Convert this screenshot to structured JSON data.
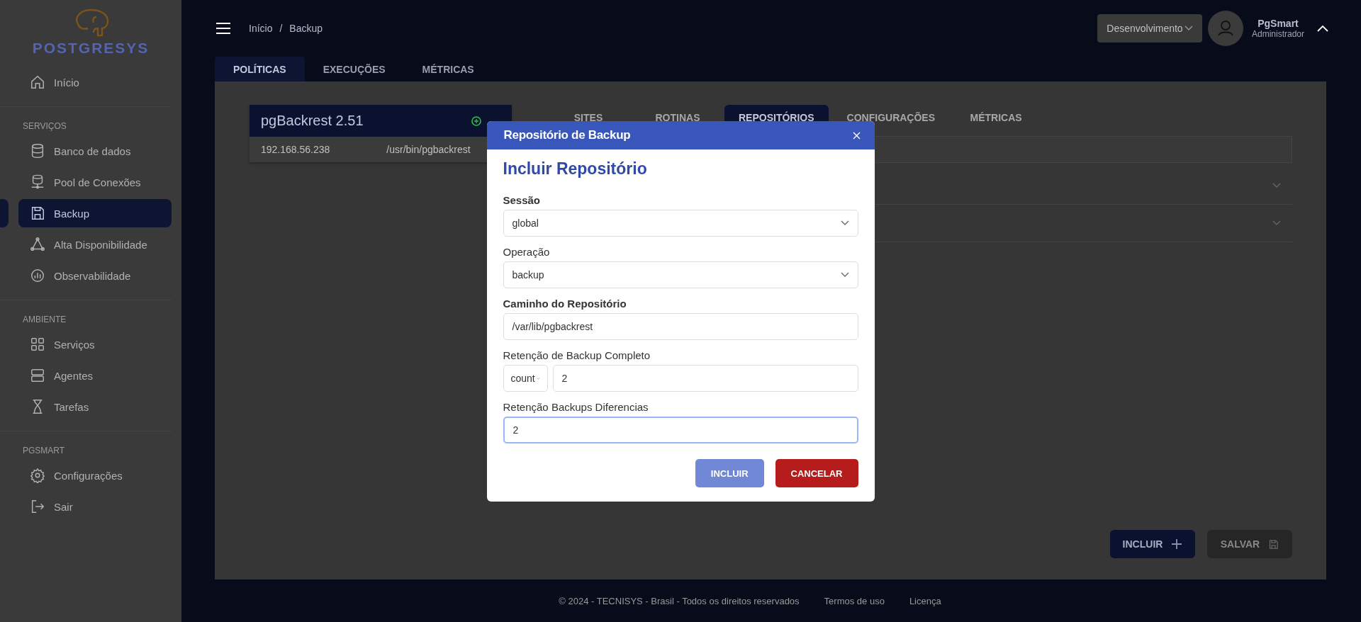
{
  "logo": {
    "text": "POSTGRESYS"
  },
  "sidebar": {
    "sections": [
      {
        "items": [
          {
            "label": "Início",
            "selected": false
          }
        ]
      },
      {
        "heading": "SERVIÇOS",
        "items": [
          {
            "label": "Banco de dados",
            "selected": false
          },
          {
            "label": "Pool de Conexões",
            "selected": false
          },
          {
            "label": "Backup",
            "selected": true
          },
          {
            "label": "Alta Disponibilidade",
            "selected": false
          },
          {
            "label": "Observabilidade",
            "selected": false
          }
        ]
      },
      {
        "heading": "AMBIENTE",
        "items": [
          {
            "label": "Serviços",
            "selected": false
          },
          {
            "label": "Agentes",
            "selected": false
          },
          {
            "label": "Tarefas",
            "selected": false
          }
        ]
      },
      {
        "heading": "PGSMART",
        "items": [
          {
            "label": "Configurações",
            "selected": false
          },
          {
            "label": "Sair",
            "selected": false
          }
        ]
      }
    ]
  },
  "breadcrumb": [
    "Início",
    "/",
    "Backup"
  ],
  "environment": {
    "value": "Desenvolvimento"
  },
  "user": {
    "name": "PgSmart",
    "role": "Administrador"
  },
  "tabs": [
    {
      "label": "POLÍTICAS",
      "selected": true
    },
    {
      "label": "EXECUÇÕES",
      "selected": false
    },
    {
      "label": "MÉTRICAS",
      "selected": false
    }
  ],
  "server_card": {
    "title": "pgBackrest 2.51",
    "host": "192.168.56.238",
    "path": "/usr/bin/pgbackrest"
  },
  "subtabs": [
    {
      "label": "SITES",
      "selected": false
    },
    {
      "label": "ROTINAS",
      "selected": false
    },
    {
      "label": "REPOSITÓRIOS",
      "selected": true
    },
    {
      "label": "CONFIGURAÇÕES",
      "selected": false
    },
    {
      "label": "MÉTRICAS",
      "selected": false
    }
  ],
  "actions": [
    {
      "label": "INCLUIR",
      "kind": "add",
      "disabled": false
    },
    {
      "label": "SALVAR",
      "kind": "save",
      "disabled": true
    }
  ],
  "footer": {
    "copyright": "© 2024 - TECNISYS - Brasil - Todos os direitos reservados",
    "links": [
      "Termos de uso",
      "Licença"
    ]
  },
  "modal": {
    "title": "Repositório de Backup",
    "heading": "Incluir Repositório",
    "fields": [
      {
        "label": "Sessão",
        "bold": true,
        "kind": "select",
        "value": "global",
        "focused": false
      },
      {
        "label": "Operação",
        "bold": false,
        "kind": "select",
        "value": "backup",
        "focused": false
      },
      {
        "label": "Caminho do Repositório",
        "bold": true,
        "kind": "text",
        "value": "/var/lib/pgbackrest",
        "focused": false
      },
      {
        "label": "Retenção de Backup Completo",
        "bold": false,
        "kind": "select_text",
        "unit": "count",
        "value": "2",
        "focused": false
      },
      {
        "label": "Retenção Backups Diferencias",
        "bold": false,
        "kind": "text",
        "value": "2",
        "focused": true
      }
    ],
    "buttons": [
      {
        "label": "INCLUIR",
        "kind": "primary",
        "disabled": true
      },
      {
        "label": "CANCELAR",
        "kind": "danger",
        "disabled": false
      }
    ]
  }
}
